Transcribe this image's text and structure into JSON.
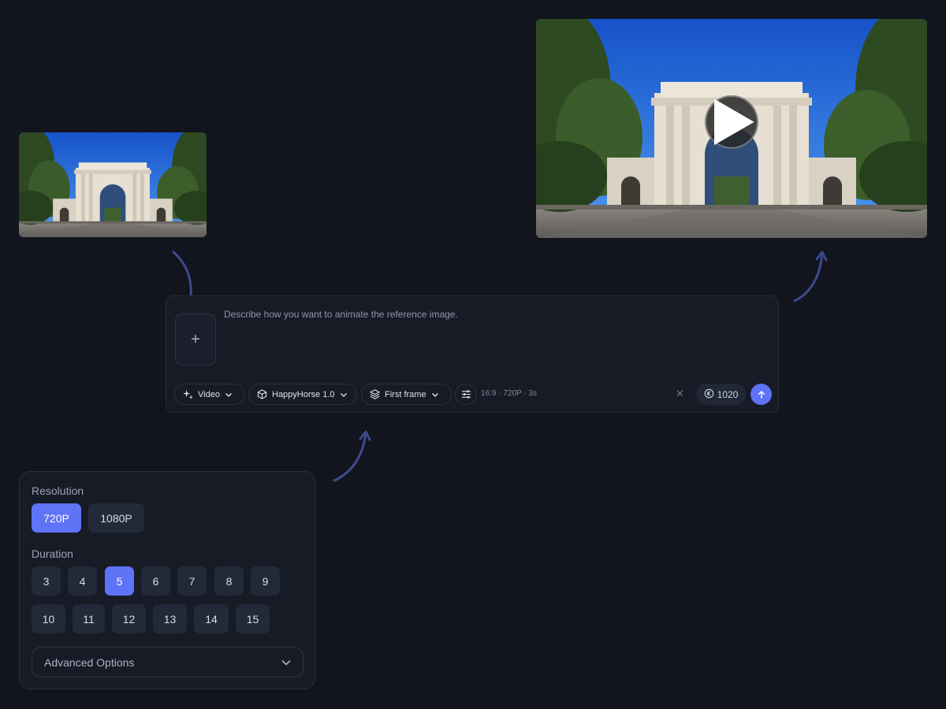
{
  "prompt": {
    "placeholder": "Describe how you want to animate the reference image.",
    "add_label": "+"
  },
  "toolbar": {
    "mode_label": "Video",
    "model_label": "HappyHorse 1.0",
    "frame_label": "First frame",
    "meta": "16:9 · 720P · 3s",
    "clear_label": "✕",
    "credits": "1020"
  },
  "settings": {
    "resolution_label": "Resolution",
    "resolutions": [
      "720P",
      "1080P"
    ],
    "selected_resolution": "720P",
    "duration_label": "Duration",
    "durations": [
      "3",
      "4",
      "5",
      "6",
      "7",
      "8",
      "9",
      "10",
      "11",
      "12",
      "13",
      "14",
      "15"
    ],
    "selected_duration": "5",
    "advanced_label": "Advanced Options"
  },
  "icons": {
    "mode": "sparkles-icon",
    "model": "cube-icon",
    "frame": "layers-icon",
    "settings": "sliders-icon",
    "credits": "coin-icon",
    "submit": "arrow-up-icon",
    "play": "play-icon",
    "expand": "chevron-down-icon"
  },
  "colors": {
    "background": "#12151e",
    "panel": "#171b26",
    "accent": "#5e73f5",
    "arrow": "#3c4a8c"
  }
}
